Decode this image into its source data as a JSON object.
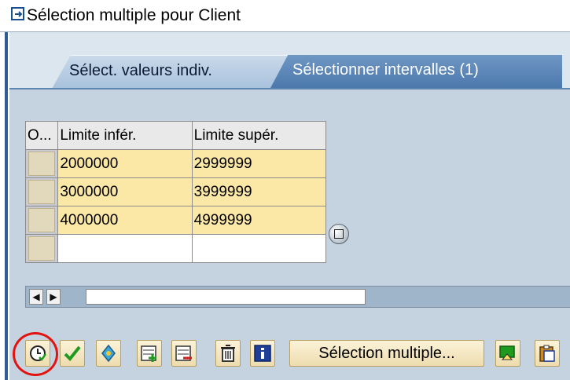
{
  "window": {
    "title": "Sélection multiple pour Client"
  },
  "tabs": [
    {
      "label": "Sélect. valeurs indiv.",
      "active": false
    },
    {
      "label": "Sélectionner intervalles (1)",
      "active": true
    }
  ],
  "table": {
    "columns": [
      "O...",
      "Limite infér.",
      "Limite supér."
    ],
    "rows": [
      {
        "lower": "2000000",
        "upper": "2999999"
      },
      {
        "lower": "3000000",
        "upper": "3999999"
      },
      {
        "lower": "4000000",
        "upper": "4999999"
      },
      {
        "lower": "",
        "upper": ""
      }
    ]
  },
  "toolbar": {
    "icons": [
      "execute-icon",
      "check-icon",
      "options-icon",
      "insert-line-icon",
      "delete-line-icon",
      "trash-icon",
      "info-icon",
      "import-icon",
      "paste-icon"
    ],
    "multiple_selection_label": "Sélection multiple...",
    "highlight_color": "#e3140f"
  },
  "colors": {
    "active_tab": "#4b78ad",
    "background": "#c5d3e1",
    "input_cell": "#fbe8a6"
  }
}
